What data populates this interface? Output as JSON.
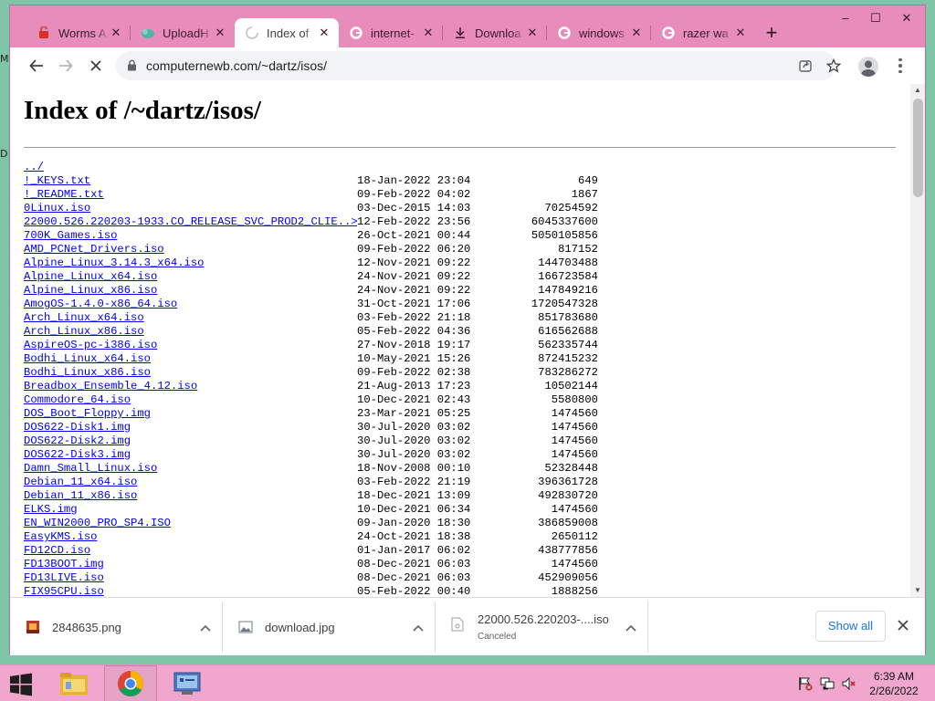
{
  "tabs": [
    {
      "title": "Worms A",
      "icon": "worms-favicon-icon"
    },
    {
      "title": "UploadH",
      "icon": "uploadhaven-favicon-icon"
    },
    {
      "title": "Index of",
      "icon": "loading-spinner-icon",
      "active": true
    },
    {
      "title": "internet-",
      "icon": "google-favicon-icon"
    },
    {
      "title": "Downloa",
      "icon": "download-favicon-icon"
    },
    {
      "title": "windows",
      "icon": "google-favicon-icon"
    },
    {
      "title": "razer wa",
      "icon": "google-favicon-icon"
    }
  ],
  "window_controls": {
    "minimize": "–",
    "maximize": "☐",
    "close": "✕"
  },
  "new_tab": "+",
  "address": {
    "url": "computernewb.com/~dartz/isos/"
  },
  "page": {
    "heading": "Index of /~dartz/isos/",
    "parent": "../",
    "entries": [
      {
        "name": "!_KEYS.txt",
        "date": "18-Jan-2022 23:04",
        "size": "649"
      },
      {
        "name": "!_README.txt",
        "date": "09-Feb-2022 04:02",
        "size": "1867"
      },
      {
        "name": "0Linux.iso",
        "date": "03-Dec-2015 14:03",
        "size": "70254592"
      },
      {
        "name": "22000.526.220203-1933.CO_RELEASE_SVC_PROD2_CLIE..>",
        "date": "12-Feb-2022 23:56",
        "size": "6045337600"
      },
      {
        "name": "700K_Games.iso",
        "date": "26-Oct-2021 00:44",
        "size": "5050105856"
      },
      {
        "name": "AMD_PCNet_Drivers.iso",
        "date": "09-Feb-2022 06:20",
        "size": "817152"
      },
      {
        "name": "Alpine_Linux_3.14.3_x64.iso",
        "date": "12-Nov-2021 09:22",
        "size": "144703488"
      },
      {
        "name": "Alpine_Linux_x64.iso",
        "date": "24-Nov-2021 09:22",
        "size": "166723584"
      },
      {
        "name": "Alpine_Linux_x86.iso",
        "date": "24-Nov-2021 09:22",
        "size": "147849216"
      },
      {
        "name": "AmogOS-1.4.0-x86_64.iso",
        "date": "31-Oct-2021 17:06",
        "size": "1720547328"
      },
      {
        "name": "Arch_Linux_x64.iso",
        "date": "03-Feb-2022 21:18",
        "size": "851783680"
      },
      {
        "name": "Arch_Linux_x86.iso",
        "date": "05-Feb-2022 04:36",
        "size": "616562688"
      },
      {
        "name": "AspireOS-pc-i386.iso",
        "date": "27-Nov-2018 19:17",
        "size": "562335744"
      },
      {
        "name": "Bodhi_Linux_x64.iso",
        "date": "10-May-2021 15:26",
        "size": "872415232"
      },
      {
        "name": "Bodhi_Linux_x86.iso",
        "date": "09-Feb-2022 02:38",
        "size": "783286272"
      },
      {
        "name": "Breadbox_Ensemble_4.12.iso",
        "date": "21-Aug-2013 17:23",
        "size": "10502144"
      },
      {
        "name": "Commodore_64.iso",
        "date": "10-Dec-2021 02:43",
        "size": "5580800"
      },
      {
        "name": "DOS_Boot_Floppy.img",
        "date": "23-Mar-2021 05:25",
        "size": "1474560"
      },
      {
        "name": "DOS622-Disk1.img",
        "date": "30-Jul-2020 03:02",
        "size": "1474560"
      },
      {
        "name": "DOS622-Disk2.img",
        "date": "30-Jul-2020 03:02",
        "size": "1474560"
      },
      {
        "name": "DOS622-Disk3.img",
        "date": "30-Jul-2020 03:02",
        "size": "1474560"
      },
      {
        "name": "Damn_Small_Linux.iso",
        "date": "18-Nov-2008 00:10",
        "size": "52328448"
      },
      {
        "name": "Debian_11_x64.iso",
        "date": "03-Feb-2022 21:19",
        "size": "396361728"
      },
      {
        "name": "Debian_11_x86.iso",
        "date": "18-Dec-2021 13:09",
        "size": "492830720"
      },
      {
        "name": "ELKS.img",
        "date": "10-Dec-2021 06:34",
        "size": "1474560"
      },
      {
        "name": "EN_WIN2000_PRO_SP4.ISO",
        "date": "09-Jan-2020 18:30",
        "size": "386859008"
      },
      {
        "name": "EasyKMS.iso",
        "date": "24-Oct-2021 18:38",
        "size": "2650112"
      },
      {
        "name": "FD12CD.iso",
        "date": "01-Jan-2017 06:02",
        "size": "438777856"
      },
      {
        "name": "FD13BOOT.img",
        "date": "08-Dec-2021 06:03",
        "size": "1474560"
      },
      {
        "name": "FD13LIVE.iso",
        "date": "08-Dec-2021 06:03",
        "size": "452909056"
      },
      {
        "name": "FIX95CPU.iso",
        "date": "05-Feb-2022 00:40",
        "size": "1888256"
      }
    ]
  },
  "downloads": [
    {
      "name": "2848635.png",
      "status": "",
      "icon": "png-file-icon"
    },
    {
      "name": "download.jpg",
      "status": "",
      "icon": "image-file-icon"
    },
    {
      "name": "22000.526.220203-....iso",
      "status": "Canceled",
      "icon": "iso-file-icon"
    }
  ],
  "downloads_bar": {
    "show_all": "Show all"
  },
  "taskbar": {
    "time": "6:39 AM",
    "date": "2/26/2022"
  },
  "colors": {
    "titlebar": "#e88cbc",
    "taskbar": "#f0a6cd",
    "desktop": "#7ec6a7",
    "link": "#0000ee",
    "visited_link": "#551a8b"
  }
}
